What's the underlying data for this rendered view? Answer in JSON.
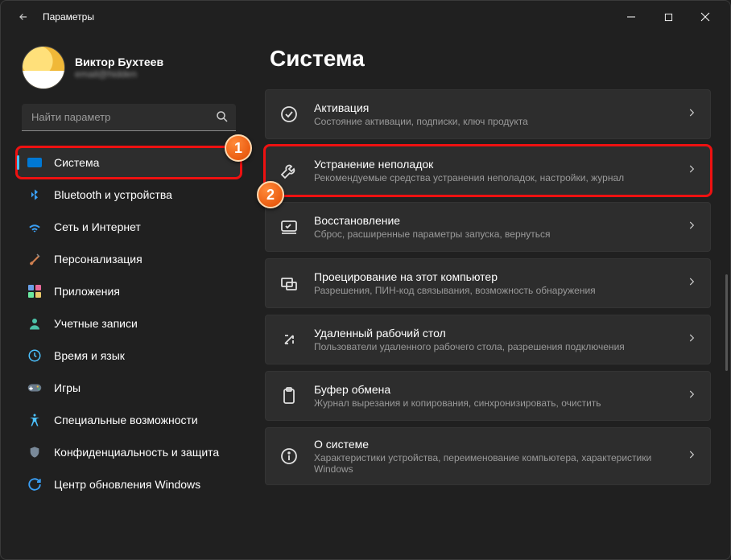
{
  "titlebar": {
    "title": "Параметры"
  },
  "profile": {
    "name": "Виктор Бухтеев",
    "email": "email@hidden"
  },
  "search": {
    "placeholder": "Найти параметр"
  },
  "sidebar": {
    "items": [
      {
        "label": "Система"
      },
      {
        "label": "Bluetooth и устройства"
      },
      {
        "label": "Сеть и Интернет"
      },
      {
        "label": "Персонализация"
      },
      {
        "label": "Приложения"
      },
      {
        "label": "Учетные записи"
      },
      {
        "label": "Время и язык"
      },
      {
        "label": "Игры"
      },
      {
        "label": "Специальные возможности"
      },
      {
        "label": "Конфиденциальность и защита"
      },
      {
        "label": "Центр обновления Windows"
      }
    ]
  },
  "main": {
    "heading": "Система",
    "cards": [
      {
        "title": "Активация",
        "desc": "Состояние активации, подписки, ключ продукта"
      },
      {
        "title": "Устранение неполадок",
        "desc": "Рекомендуемые средства устранения неполадок, настройки, журнал"
      },
      {
        "title": "Восстановление",
        "desc": "Сброс, расширенные параметры запуска, вернуться"
      },
      {
        "title": "Проецирование на этот компьютер",
        "desc": "Разрешения, ПИН-код связывания, возможность обнаружения"
      },
      {
        "title": "Удаленный рабочий стол",
        "desc": "Пользователи удаленного рабочего стола, разрешения подключения"
      },
      {
        "title": "Буфер обмена",
        "desc": "Журнал вырезания и копирования, синхронизировать, очистить"
      },
      {
        "title": "О системе",
        "desc": "Характеристики устройства, переименование компьютера, характеристики Windows"
      }
    ]
  },
  "markers": {
    "one": "1",
    "two": "2"
  }
}
